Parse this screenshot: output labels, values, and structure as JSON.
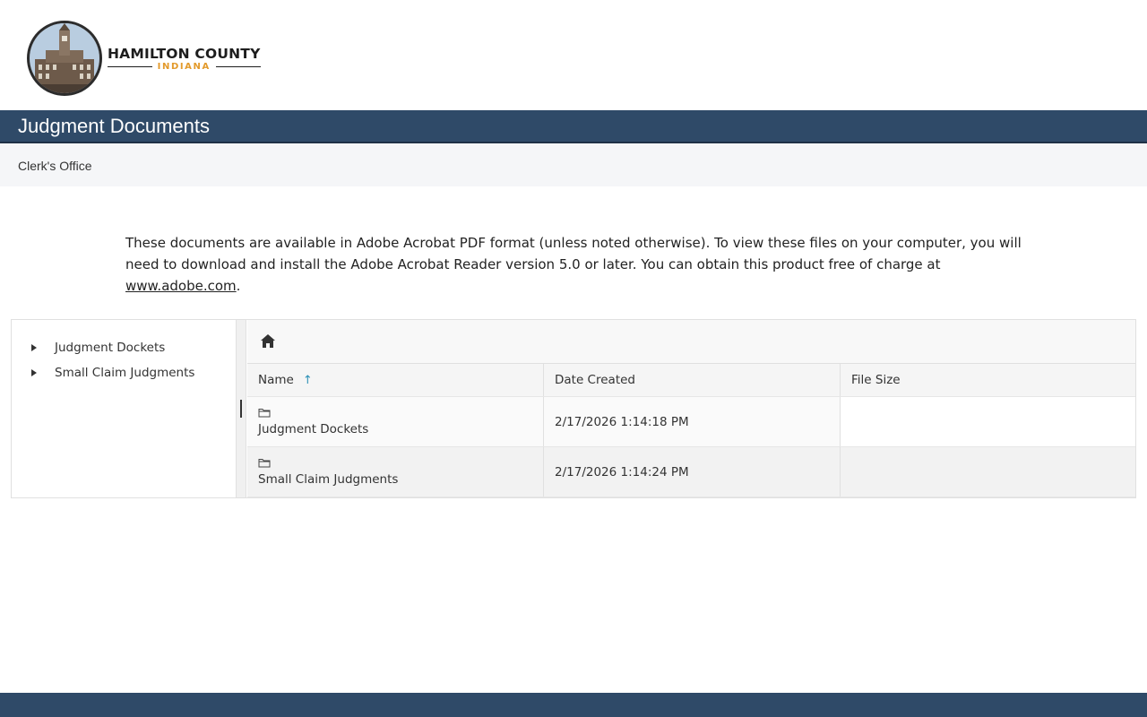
{
  "header": {
    "logo_title": "HAMILTON COUNTY",
    "logo_subtitle": "INDIANA"
  },
  "page": {
    "title": "Judgment Documents",
    "breadcrumb": "Clerk's Office"
  },
  "intro": {
    "text": "These documents are available in Adobe Acrobat PDF format (unless noted otherwise). To view these files on your computer, you will need to download and install the Adobe Acrobat Reader version 5.0 or later. You can obtain this product free of charge at ",
    "link_text": "www.adobe.com",
    "after_link": "."
  },
  "file_manager": {
    "tree": [
      {
        "label": "Judgment Dockets"
      },
      {
        "label": "Small Claim Judgments"
      }
    ],
    "toolbar": {
      "home_icon": "home-icon"
    },
    "columns": {
      "name": "Name",
      "sort_indicator": "↑",
      "date_created": "Date Created",
      "file_size": "File Size"
    },
    "rows": [
      {
        "name": "Judgment Dockets",
        "date_created": "2/17/2026 1:14:18 PM",
        "file_size": ""
      },
      {
        "name": "Small Claim Judgments",
        "date_created": "2/17/2026 1:14:24 PM",
        "file_size": ""
      }
    ]
  },
  "colors": {
    "title_bar": "#2f4a68",
    "footer": "#2f4a68",
    "sort_accent": "#2a8fb5",
    "logo_subtitle": "#e39a2b"
  }
}
